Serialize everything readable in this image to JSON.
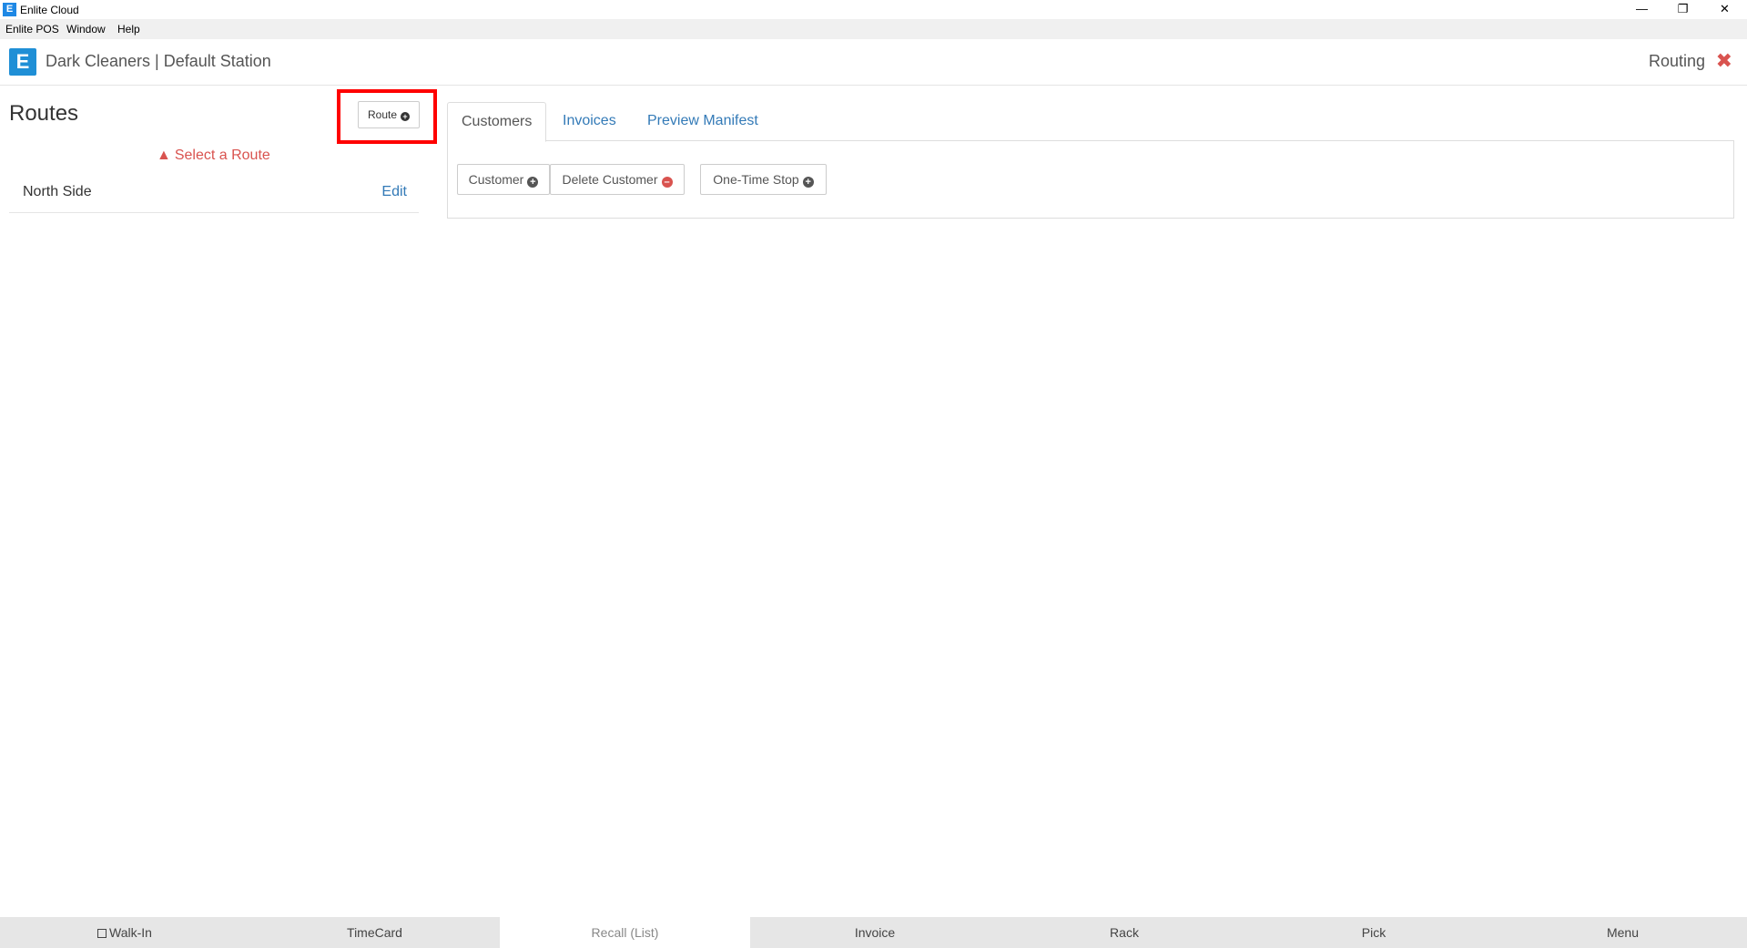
{
  "window": {
    "title": "Enlite Cloud",
    "app_icon": "E",
    "controls": {
      "minimize": "—",
      "restore": "❐",
      "close": "✕"
    }
  },
  "menubar": {
    "items": [
      "Enlite POS",
      "Window",
      "Help"
    ]
  },
  "header": {
    "logo": "E",
    "station": "Dark Cleaners | Default Station",
    "module": "Routing",
    "close_icon": "✖"
  },
  "routes": {
    "title": "Routes",
    "add_button": "Route",
    "warning": "Select a Route",
    "items": [
      {
        "name": "North Side",
        "action": "Edit"
      }
    ]
  },
  "tabs": [
    "Customers",
    "Invoices",
    "Preview Manifest"
  ],
  "toolbar": {
    "add_customer": "Customer",
    "delete_customer": "Delete Customer",
    "one_time_stop": "One-Time Stop"
  },
  "bottomnav": [
    "Walk-In",
    "TimeCard",
    "Recall (List)",
    "Invoice",
    "Rack",
    "Pick",
    "Menu"
  ],
  "colors": {
    "accent": "#337ab7",
    "danger": "#d9534f",
    "highlight": "#ff0000",
    "logo": "#1f8fd6"
  }
}
